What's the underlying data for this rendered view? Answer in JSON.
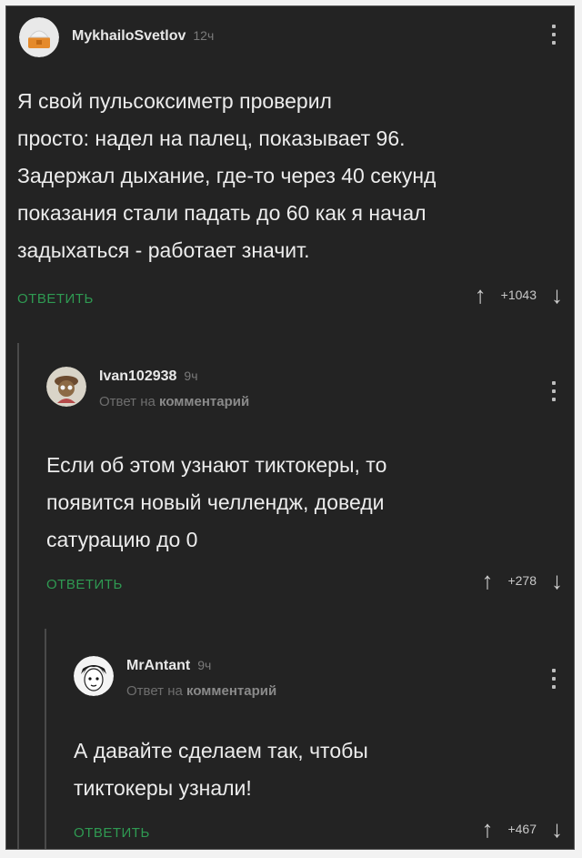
{
  "comments": [
    {
      "username": "MykhailoSvetlov",
      "time": "12ч",
      "text": "Я свой пульсоксиметр проверил\nпросто: надел на палец, показывает 96.\nЗадержал дыхание, где-то через 40 секунд\nпоказания стали падать до 60 как я начал\nзадыхаться - работает значит.",
      "reply_label": "ОТВЕТИТЬ",
      "score": "+1043",
      "up_icon": "↑",
      "down_icon": "↓"
    },
    {
      "username": "Ivan102938",
      "time": "9ч",
      "reply_prefix": "Ответ на",
      "reply_target": "комментарий",
      "text": "Если об этом узнают тиктокеры, то\nпоявится новый челлендж, доведи\nсатурацию до 0",
      "reply_label": "ОТВЕТИТЬ",
      "score": "+278",
      "up_icon": "↑",
      "down_icon": "↓"
    },
    {
      "username": "MrAntant",
      "time": "9ч",
      "reply_prefix": "Ответ на",
      "reply_target": "комментарий",
      "text": "А давайте сделаем так, чтобы\nтиктокеры узнали!",
      "reply_label": "ОТВЕТИТЬ",
      "score": "+467",
      "up_icon": "↑",
      "down_icon": "↓"
    }
  ],
  "colors": {
    "background": "#232323",
    "accent_green": "#2f9a52",
    "text": "#ececec",
    "muted": "#7a7a7a"
  }
}
